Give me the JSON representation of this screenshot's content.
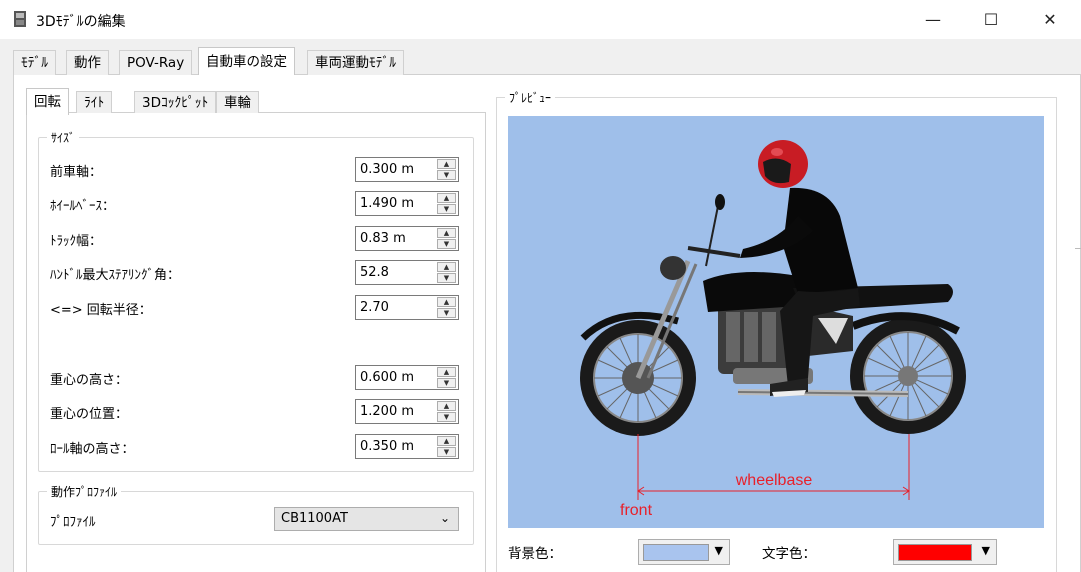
{
  "window": {
    "title": "3Dﾓﾃﾞﾙの編集",
    "controls": {
      "minimize": "—",
      "maximize": "☐",
      "close": "✕"
    }
  },
  "main_tabs": [
    {
      "label": "ﾓﾃﾞﾙ",
      "active": false
    },
    {
      "label": "動作",
      "active": false
    },
    {
      "label": "POV-Ray",
      "active": false
    },
    {
      "label": "自動車の設定",
      "active": true
    },
    {
      "label": "車両運動ﾓﾃﾞﾙ",
      "active": false
    }
  ],
  "sub_tabs": [
    {
      "label": "回転",
      "active": true
    },
    {
      "label": "ﾗｲﾄ",
      "active": false
    },
    {
      "label": "3Dｺｯｸﾋﾟｯﾄ",
      "active": false
    },
    {
      "label": "車輪",
      "active": false
    }
  ],
  "size_group": {
    "title": "ｻｲｽﾞ",
    "rows": [
      {
        "label": "前車軸：",
        "value": "0.300 m"
      },
      {
        "label": "ﾎｲｰﾙﾍﾞｰｽ：",
        "value": "1.490 m"
      },
      {
        "label": "ﾄﾗｯｸ幅：",
        "value": "0.83 m"
      },
      {
        "label": "ﾊﾝﾄﾞﾙ最大ｽﾃｱﾘﾝｸﾞ角：",
        "value": "52.8"
      },
      {
        "label": "<=> 回転半径：",
        "value": "2.70"
      },
      {
        "label": "重心の高さ：",
        "value": "0.600 m"
      },
      {
        "label": "重心の位置：",
        "value": "1.200 m"
      },
      {
        "label": "ﾛｰﾙ軸の高さ：",
        "value": "0.350 m"
      }
    ]
  },
  "profile_group": {
    "title": "動作ﾌﾟﾛﾌｧｲﾙ",
    "label": "ﾌﾟﾛﾌｧｲﾙ",
    "selected": "CB1100AT"
  },
  "preview": {
    "title": "ﾌﾟﾚﾋﾞｭｰ",
    "wheelbase_label": "wheelbase",
    "front_label": "front"
  },
  "colors": {
    "bg_label": "背景色：",
    "bg_value": "#a9c4ee",
    "text_label": "文字色：",
    "text_value": "#ff0000",
    "annotation": "#e8202a"
  }
}
